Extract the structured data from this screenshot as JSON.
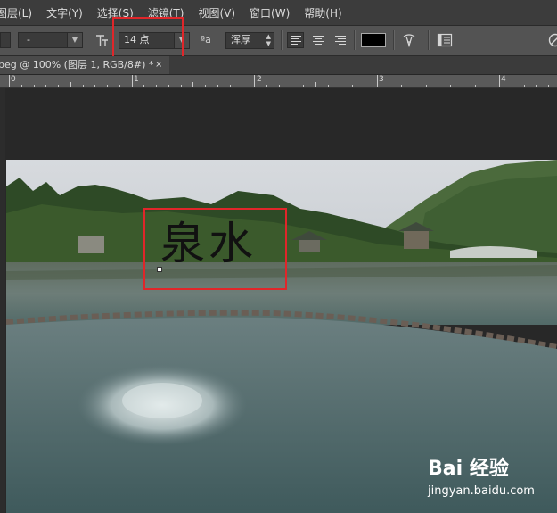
{
  "menu": {
    "items": [
      "图层(L)",
      "文字(Y)",
      "选择(S)",
      "滤镜(T)",
      "视图(V)",
      "窗口(W)",
      "帮助(H)"
    ]
  },
  "options": {
    "font_family_value": "",
    "font_style_value": "-",
    "size_icon": "text-size-icon",
    "font_size_value": "14 点",
    "aa_icon_text": "ªa",
    "antialias_value": "浑厚",
    "text_color": "#000000",
    "highlight_color": "#e0262a"
  },
  "document": {
    "tab_label": "peg @ 100% (图层 1, RGB/8#) *",
    "close_glyph": "×"
  },
  "ruler": {
    "labels": [
      "0",
      "1",
      "2",
      "3",
      "4"
    ]
  },
  "canvas": {
    "text_layer": "泉水"
  },
  "watermark": {
    "brand": "Bai 经验",
    "sub": "jingyan.baidu.com"
  }
}
